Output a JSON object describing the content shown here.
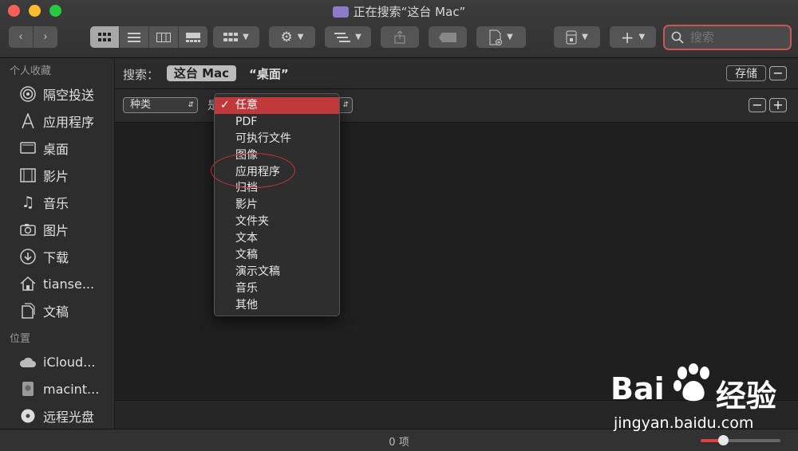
{
  "window": {
    "title": "正在搜索“这台 Mac”"
  },
  "toolbar": {
    "view_modes": [
      "icon-view",
      "list-view",
      "column-view",
      "gallery-view"
    ],
    "search_placeholder": "搜索"
  },
  "sidebar": {
    "favorites_title": "个人收藏",
    "favorites": [
      {
        "label": "隔空投送",
        "icon": "airdrop-icon"
      },
      {
        "label": "应用程序",
        "icon": "applications-icon"
      },
      {
        "label": "桌面",
        "icon": "desktop-icon"
      },
      {
        "label": "影片",
        "icon": "movies-icon"
      },
      {
        "label": "音乐",
        "icon": "music-icon"
      },
      {
        "label": "图片",
        "icon": "pictures-icon"
      },
      {
        "label": "下载",
        "icon": "downloads-icon"
      },
      {
        "label": "tianse...",
        "icon": "home-icon"
      },
      {
        "label": "文稿",
        "icon": "documents-icon"
      }
    ],
    "locations_title": "位置",
    "locations": [
      {
        "label": "iCloud...",
        "icon": "cloud-icon"
      },
      {
        "label": "macint...",
        "icon": "disk-icon"
      },
      {
        "label": "远程光盘",
        "icon": "optical-disc-icon"
      }
    ]
  },
  "searchbar": {
    "label": "搜索：",
    "scope_selected": "这台 Mac",
    "scope_other": "“桌面”",
    "save_label": "存储",
    "remove_label": "−"
  },
  "criteria": {
    "attribute": "种类",
    "operator_prefix": "是",
    "remove_label": "−",
    "add_label": "+"
  },
  "kind_menu": {
    "selected_index": 0,
    "items": [
      "任意",
      "PDF",
      "可执行文件",
      "图像",
      "应用程序",
      "归档",
      "影片",
      "文件夹",
      "文本",
      "文稿",
      "演示文稿",
      "音乐",
      "其他"
    ]
  },
  "status": {
    "item_count": "0 项",
    "zoom_level": 0.28
  },
  "watermark": {
    "brand_left": "Bai",
    "brand_right": "经验",
    "url": "jingyan.baidu.com"
  },
  "colors": {
    "accent": "#c0393b",
    "annotation": "#c8343a"
  }
}
